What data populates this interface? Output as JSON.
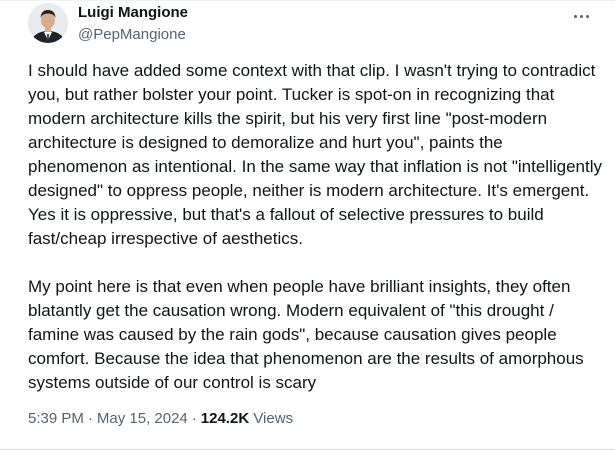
{
  "author": {
    "display_name": "Luigi Mangione",
    "handle": "@PepMangione",
    "avatar_icon": "profile-photo",
    "more_icon": "more-dots-icon"
  },
  "tweet": {
    "paragraphs": [
      "I should have added some context with that clip. I wasn't trying to contradict you, but rather bolster your point. Tucker is spot-on in recognizing that modern architecture kills the spirit, but his very first line \"post-modern architecture is designed to demoralize and hurt you\", paints the phenomenon as intentional. In the same way that inflation is not \"intelligently designed\" to oppress people, neither is modern architecture. It's emergent. Yes it is oppressive, but that's a fallout of selective pressures to build fast/cheap irrespective of aesthetics.",
      "My point here is that even when people have brilliant insights, they often blatantly get the causation wrong. Modern equivalent of \"this drought / famine was caused by the rain gods\", because causation gives people comfort. Because the idea that phenomenon are the results of amorphous systems outside of our control is scary"
    ]
  },
  "meta": {
    "time": "5:39 PM",
    "separator": "·",
    "date": "May 15, 2024",
    "views_count": "124.2K",
    "views_label": "Views"
  },
  "colors": {
    "text": "#0f1419",
    "secondary": "#536471",
    "divider": "#cfd9de"
  }
}
